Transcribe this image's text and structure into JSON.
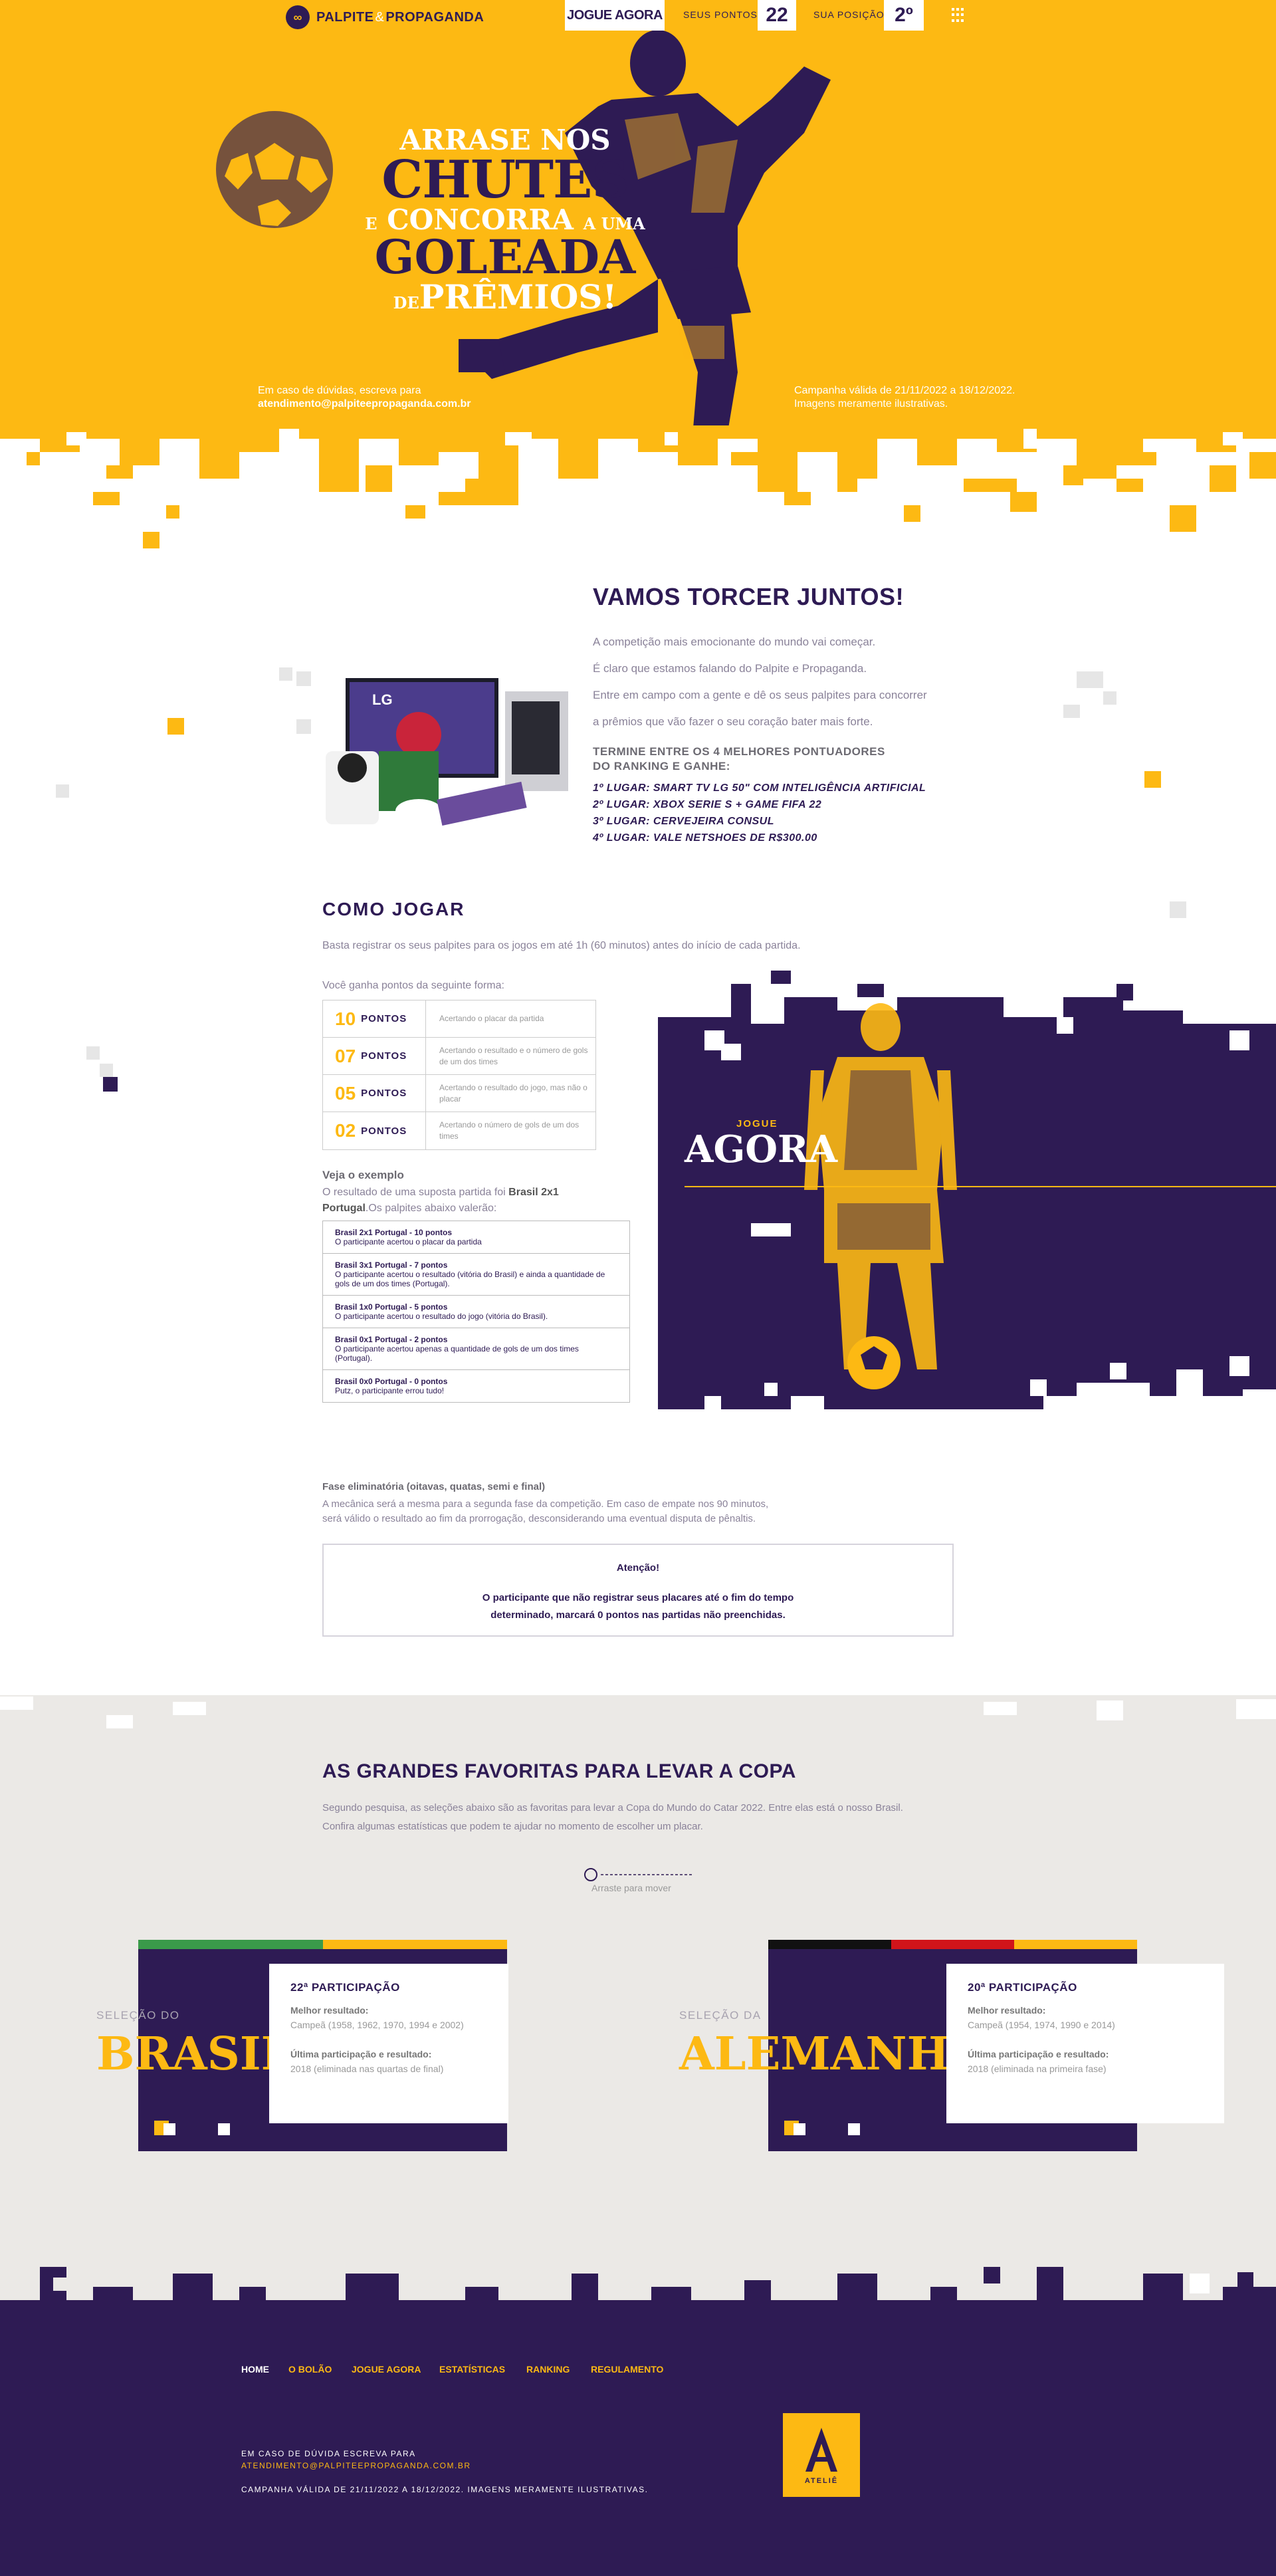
{
  "header": {
    "logo_left": "PALPITE",
    "logo_amp": "&",
    "logo_right": "PROPAGANDA",
    "cta_label": "JOGUE AGORA",
    "points_label": "SEUS PONTOS",
    "points_value": "22",
    "position_label": "SUA POSIÇÃO",
    "position_value": "2º",
    "menu_icon": "grid-menu-icon"
  },
  "hero": {
    "line1": "ARRASE NOS",
    "line2": "CHUTES",
    "line3_small": "E",
    "line3": "CONCORRA",
    "line3_small2": "A UMA",
    "line4": "GOLEADA",
    "line5_small": "DE",
    "line5": "PRÊMIOS!",
    "contact_text": "Em caso de dúvidas, escreva para",
    "contact_email": "atendimento@palpiteepropaganda.com.br",
    "campaign_line1": "Campanha válida de 21/11/2022 a 18/12/2022.",
    "campaign_line2": "Imagens meramente ilustrativas."
  },
  "vamos": {
    "title": "VAMOS TORCER JUNTOS!",
    "p1": "A competição mais emocionante do mundo vai começar.",
    "p2": "É claro que estamos falando do Palpite e Propaganda.",
    "p3": "Entre em campo com a gente e dê os seus palpites para concorrer",
    "p4": "a prêmios que vão fazer o seu coração bater mais forte.",
    "prize_head1": "TERMINE ENTRE OS 4 MELHORES PONTUADORES",
    "prize_head2": "DO RANKING E GANHE:",
    "prizes": [
      "1º LUGAR: SMART TV LG 50\" COM INTELIGÊNCIA ARTIFICIAL",
      "2º LUGAR: XBOX SERIE S + GAME FIFA 22",
      "3º LUGAR: CERVEJEIRA CONSUL",
      "4º LUGAR: VALE NETSHOES DE R$300.00"
    ]
  },
  "como": {
    "title": "COMO JOGAR",
    "intro": "Basta registrar os seus palpites para os jogos em até 1h (60 minutos) antes do início de cada partida.",
    "pts_intro": "Você ganha pontos da seguinte forma:",
    "points": [
      {
        "num": "10",
        "word": "PONTOS",
        "desc": "Acertando o placar da partida"
      },
      {
        "num": "07",
        "word": "PONTOS",
        "desc": "Acertando o resultado e o número de gols de um dos times"
      },
      {
        "num": "05",
        "word": "PONTOS",
        "desc": "Acertando o resultado do jogo, mas não o placar"
      },
      {
        "num": "02",
        "word": "PONTOS",
        "desc": "Acertando o número de gols de um dos times"
      }
    ],
    "ex_title": "Veja o exemplo",
    "ex_intro_a": "O resultado de uma suposta partida foi ",
    "ex_intro_b": "Brasil 2x1",
    "ex_intro_c": "Portugal",
    "ex_intro_d": ".Os palpites abaixo valerão:",
    "examples": [
      {
        "title": "Brasil 2x1 Portugal - 10 pontos",
        "desc": "O participante acertou o placar da partida"
      },
      {
        "title": "Brasil 3x1 Portugal - 7 pontos",
        "desc": "O participante acertou o resultado (vitória do Brasil) e ainda a quantidade de gols de um dos times (Portugal)."
      },
      {
        "title": "Brasil 1x0 Portugal - 5 pontos",
        "desc": "O participante acertou o resultado do jogo (vitória do Brasil)."
      },
      {
        "title": "Brasil 0x1 Portugal - 2 pontos",
        "desc": "O participante acertou apenas a quantidade de gols de um dos times (Portugal)."
      },
      {
        "title": "Brasil 0x0 Portugal - 0 pontos",
        "desc": "Putz, o participante errou tudo!"
      }
    ],
    "agora_small": "JOGUE",
    "agora_big": "AGORA",
    "fase_title": "Fase eliminatória (oitavas, quatas, semi e final)",
    "fase_text1": "A mecânica será a mesma para a segunda fase da competição. Em caso de empate nos 90 minutos,",
    "fase_text2": "será válido o resultado ao fim da prorrogação, desconsiderando uma eventual disputa de pênaltis.",
    "attn_title": "Atenção!",
    "attn_text1": "O participante que não registrar seus placares até o fim do tempo",
    "attn_text2": "determinado, marcará 0 pontos nas partidas não preenchidas."
  },
  "favoritas": {
    "title": "AS GRANDES FAVORITAS PARA LEVAR A COPA",
    "p1": "Segundo pesquisa, as seleções abaixo são as favoritas para levar a Copa do Mundo do Catar 2022. Entre elas está o nosso Brasil.",
    "p2": "Confira algumas estatísticas que podem te ajudar no momento de escolher um placar.",
    "drag_hint": "Arraste para mover",
    "teams": [
      {
        "pre": "SELEÇÃO DO",
        "name": "BRASIL",
        "participation": "22ª PARTICIPAÇÃO",
        "best_label": "Melhor resultado:",
        "best_value": "Campeã (1958, 1962, 1970, 1994 e 2002)",
        "last_label": "Última participação e resultado:",
        "last_value": "2018 (eliminada nas quartas de final)",
        "flag_colors": [
          "#3a9a4a",
          "#fdb913"
        ]
      },
      {
        "pre": "SELEÇÃO DA",
        "name": "ALEMANHA",
        "participation": "20ª PARTICIPAÇÃO",
        "best_label": "Melhor resultado:",
        "best_value": "Campeã (1954, 1974, 1990 e 2014)",
        "last_label": "Última participação e resultado:",
        "last_value": "2018 (eliminada na primeira fase)",
        "flag_colors": [
          "#111111",
          "#d0141a",
          "#fdb913"
        ]
      }
    ]
  },
  "footer": {
    "nav": [
      "HOME",
      "O BOLÃO",
      "JOGUE AGORA",
      "ESTATÍSTICAS",
      "RANKING",
      "REGULAMENTO"
    ],
    "contact_label": "EM CASO DE DÚVIDA ESCREVA PARA",
    "contact_email": "ATENDIMENTO@PALPITEEPROPAGANDA.COM.BR",
    "campaign": "CAMPANHA VÁLIDA DE 21/11/2022 A 18/12/2022. IMAGENS MERAMENTE ILUSTRATIVAS.",
    "badge_text": "ATELIÊ"
  },
  "colors": {
    "yellow": "#fdb913",
    "purple": "#2e1b54",
    "light_gray": "#ebe9e6"
  }
}
